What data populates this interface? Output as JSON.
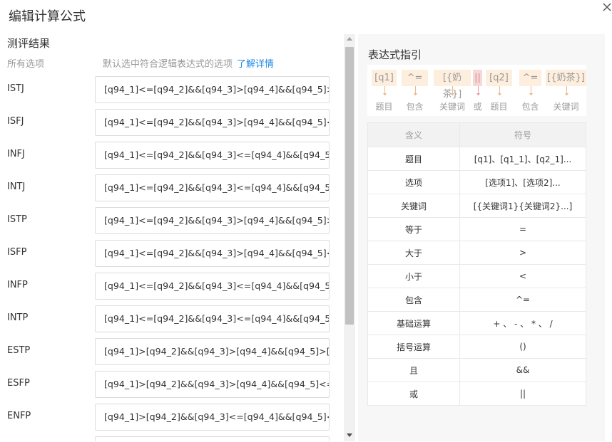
{
  "dialog": {
    "title": "编辑计算公式"
  },
  "section": {
    "title": "测评结果",
    "col_all_options": "所有选项",
    "col_hint": "默认选中符合逻辑表达式的选项",
    "col_hint_link": "了解详情"
  },
  "rows": [
    {
      "label": "ISTJ",
      "expr": "[q94_1]<=[q94_2]&&[q94_3]>[q94_4]&&[q94_5]>"
    },
    {
      "label": "ISFJ",
      "expr": "[q94_1]<=[q94_2]&&[q94_3]>[q94_4]&&[q94_5]<"
    },
    {
      "label": "INFJ",
      "expr": "[q94_1]<=[q94_2]&&[q94_3]<=[q94_4]&&[q94_5]"
    },
    {
      "label": "INTJ",
      "expr": "[q94_1]<=[q94_2]&&[q94_3]<=[q94_4]&&[q94_5]"
    },
    {
      "label": "ISTP",
      "expr": "[q94_1]<=[q94_2]&&[q94_3]>[q94_4]&&[q94_5]>"
    },
    {
      "label": "ISFP",
      "expr": "[q94_1]<=[q94_2]&&[q94_3]>[q94_4]&&[q94_5]<"
    },
    {
      "label": "INFP",
      "expr": "[q94_1]<=[q94_2]&&[q94_3]<=[q94_4]&&[q94_5]"
    },
    {
      "label": "INTP",
      "expr": "[q94_1]<=[q94_2]&&[q94_3]<=[q94_4]&&[q94_5]"
    },
    {
      "label": "ESTP",
      "expr": "[q94_1]>[q94_2]&&[q94_3]>[q94_4]&&[q94_5]>[c"
    },
    {
      "label": "ESFP",
      "expr": "[q94_1]>[q94_2]&&[q94_3]>[q94_4]&&[q94_5]<="
    },
    {
      "label": "ENFP",
      "expr": "[q94_1]>[q94_2]&&[q94_3]<=[q94_4]&&[q94_5]<"
    },
    {
      "label": "",
      "expr": ""
    }
  ],
  "guide": {
    "title": "表达式指引",
    "tokens": [
      "[q1]",
      "^=",
      "[{奶茶}]",
      "||",
      "[q2]",
      "^=",
      "[{奶茶}]"
    ],
    "captions": [
      "题目",
      "包含",
      "关键词",
      "或",
      "题目",
      "包含",
      "关键词"
    ],
    "table_header": {
      "meaning": "含义",
      "symbol": "符号"
    },
    "table_rows": [
      {
        "meaning": "题目",
        "symbol": "[q1]、[q1_1]、[q2_1]..."
      },
      {
        "meaning": "选项",
        "symbol": "[选项1]、[选项2]..."
      },
      {
        "meaning": "关键词",
        "symbol": "[{关键词1}{关键词2}...]"
      },
      {
        "meaning": "等于",
        "symbol": "="
      },
      {
        "meaning": "大于",
        "symbol": ">"
      },
      {
        "meaning": "小于",
        "symbol": "<"
      },
      {
        "meaning": "包含",
        "symbol": "^="
      },
      {
        "meaning": "基础运算",
        "symbol": "+ 、 - 、 * 、 /"
      },
      {
        "meaning": "括号运算",
        "symbol": "()"
      },
      {
        "meaning": "且",
        "symbol": "&&"
      },
      {
        "meaning": "或",
        "symbol": "||"
      }
    ]
  }
}
